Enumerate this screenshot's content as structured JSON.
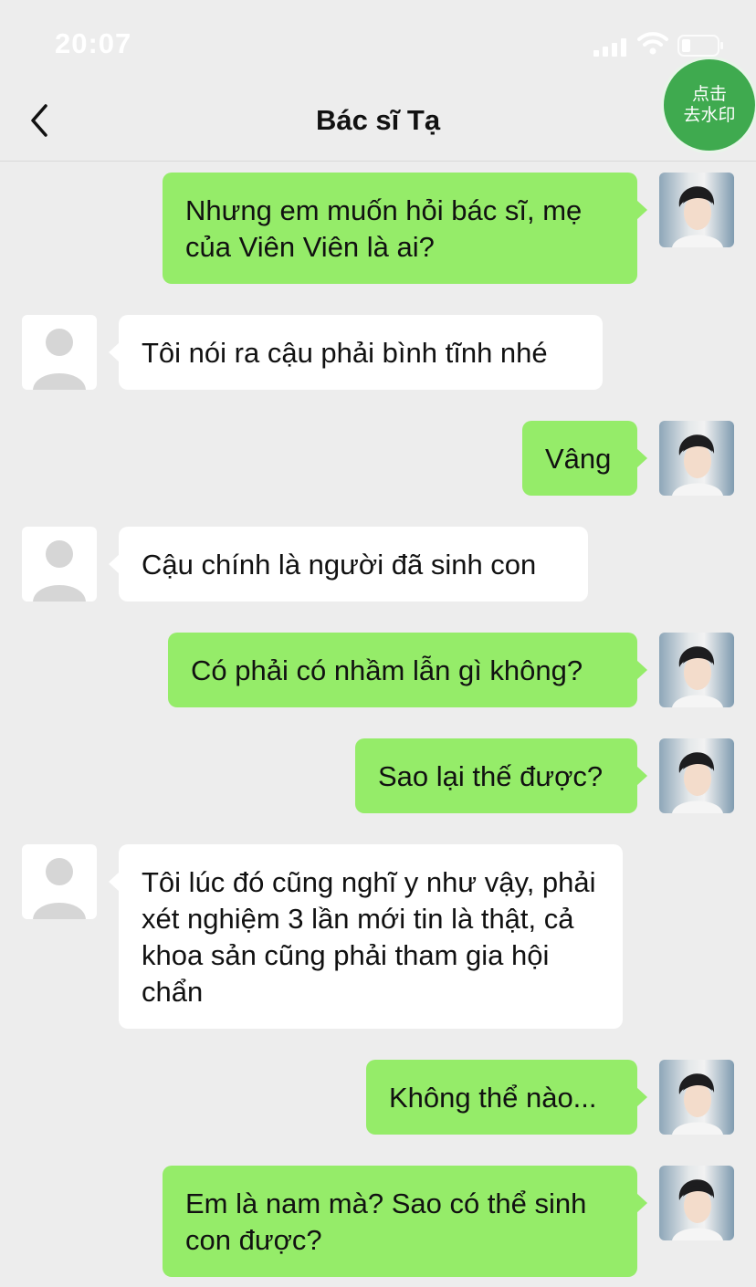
{
  "status_bar": {
    "time": "20:07"
  },
  "nav": {
    "title": "Bác sĩ Tạ"
  },
  "watermark_button": {
    "line1": "点击",
    "line2": "去水印"
  },
  "messages": [
    {
      "side": "out",
      "text": "Nhưng em muốn hỏi bác sĩ, mẹ của Viên Viên là ai?"
    },
    {
      "side": "in",
      "text": "Tôi nói ra cậu phải bình tĩnh nhé"
    },
    {
      "side": "out",
      "text": "Vâng"
    },
    {
      "side": "in",
      "text": "Cậu chính là người đã sinh con"
    },
    {
      "side": "out",
      "text": "Có phải có nhầm lẫn gì không?"
    },
    {
      "side": "out",
      "text": "Sao lại thế được?"
    },
    {
      "side": "in",
      "text": "Tôi lúc đó cũng nghĩ y như vậy, phải xét nghiệm 3 lần mới tin là thật, cả khoa sản cũng phải tham gia hội chẩn"
    },
    {
      "side": "out",
      "text": "Không thể nào..."
    },
    {
      "side": "out",
      "text": "Em là nam mà? Sao có thể sinh con được?"
    }
  ],
  "colors": {
    "outgoing_bubble": "#95ec69",
    "incoming_bubble": "#ffffff",
    "background": "#ededed",
    "watermark_button": "#3faa4f"
  }
}
